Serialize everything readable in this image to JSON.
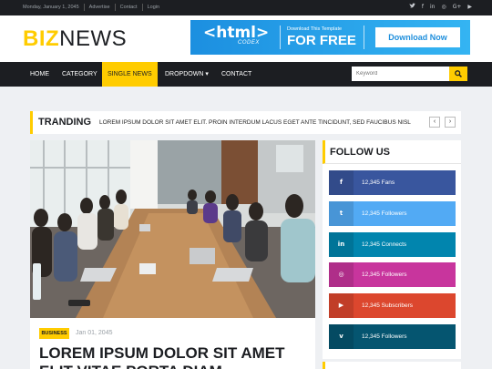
{
  "topbar": {
    "date": "Monday, January 1, 2045",
    "links": [
      "Advertise",
      "Contact",
      "Login"
    ],
    "social_icons": [
      "twitter-icon",
      "facebook-icon",
      "linkedin-icon",
      "instagram-icon",
      "google-plus-icon",
      "youtube-icon"
    ]
  },
  "logo": {
    "part1": "BIZ",
    "part2": "NEWS"
  },
  "ad": {
    "brand": "<html>",
    "brand_sub": "CODEX",
    "small_text": "Download This Template",
    "big_text": "FOR FREE",
    "button": "Download Now"
  },
  "nav": {
    "items": [
      "HOME",
      "CATEGORY",
      "SINGLE NEWS",
      "DROPDOWN ▾",
      "CONTACT"
    ],
    "active_index": 2,
    "search_placeholder": "Keyword"
  },
  "trending": {
    "label": "TRANDING",
    "text": "LOREM IPSUM DOLOR SIT AMET ELIT. PROIN INTERDUM LACUS EGET ANTE TINCIDUNT, SED FAUCIBUS NISL",
    "prev": "‹",
    "next": "›"
  },
  "article": {
    "category": "BUSINESS",
    "date": "Jan 01, 2045",
    "headline": "LOREM IPSUM DOLOR SIT AMET ELIT VITAE PORTA DIAM..."
  },
  "follow": {
    "title": "FOLLOW US",
    "rows": [
      {
        "icon": "facebook-icon",
        "glyph": "f",
        "label": "12,345 Fans",
        "color": "#39569E"
      },
      {
        "icon": "twitter-icon",
        "glyph": "t",
        "label": "12,345 Followers",
        "color": "#52AAF4"
      },
      {
        "icon": "linkedin-icon",
        "glyph": "in",
        "label": "12,345 Connects",
        "color": "#0185AE"
      },
      {
        "icon": "instagram-icon",
        "glyph": "◎",
        "label": "12,345 Followers",
        "color": "#C8359D"
      },
      {
        "icon": "youtube-icon",
        "glyph": "▶",
        "label": "12,345 Subscribers",
        "color": "#DC472E"
      },
      {
        "icon": "vimeo-icon",
        "glyph": "v",
        "label": "12,345 Followers",
        "color": "#055570"
      }
    ]
  },
  "colors": {
    "accent": "#FFCC00",
    "dark": "#1C1E22",
    "ad_blue": "#2B9FE6"
  }
}
